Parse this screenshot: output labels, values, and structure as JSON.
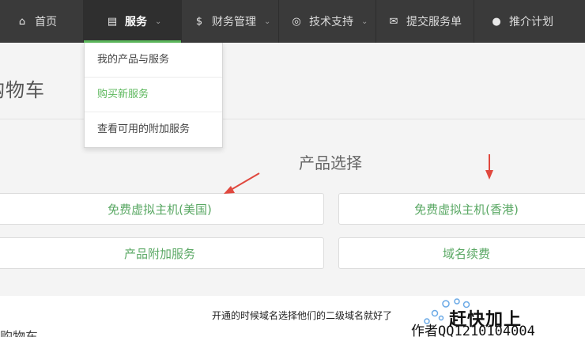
{
  "nav": {
    "items": [
      {
        "icon": "home-icon",
        "glyph": "⌂",
        "label": "首页",
        "chevron": false
      },
      {
        "icon": "list-icon",
        "glyph": "▤",
        "label": "服务",
        "chevron": true,
        "active": true
      },
      {
        "icon": "dollar-icon",
        "glyph": "$",
        "label": "财务管理",
        "chevron": true
      },
      {
        "icon": "lifebuoy-icon",
        "glyph": "◎",
        "label": "技术支持",
        "chevron": true
      },
      {
        "icon": "envelope-icon",
        "glyph": "✉",
        "label": "提交服务单",
        "chevron": false
      },
      {
        "icon": "user-icon",
        "glyph": "●",
        "label": "推介计划",
        "chevron": false
      }
    ],
    "chevron_glyph": "⌄"
  },
  "page": {
    "cart_title": "购物车",
    "section_title": "产品选择"
  },
  "dropdown": {
    "items": [
      {
        "label": "我的产品与服务"
      },
      {
        "label": "购买新服务"
      },
      {
        "label": "查看可用的附加服务"
      }
    ]
  },
  "products": {
    "free_host_us": "免费虚拟主机(美国)",
    "free_host_hk": "免费虚拟主机(香港)",
    "addon_services": "产品附加服务",
    "domain_renew": "域名续费"
  },
  "bottom": {
    "note": "开通的时候域名选择他们的二级域名就好了",
    "partial_text": "购物车"
  },
  "watermark": {
    "slogan": "赶快加上",
    "author": "作者QQ1210104004"
  },
  "colors": {
    "nav_bg": "#3a3a3a",
    "accent_green": "#5cb85c",
    "arrow_red": "#e0483e"
  }
}
